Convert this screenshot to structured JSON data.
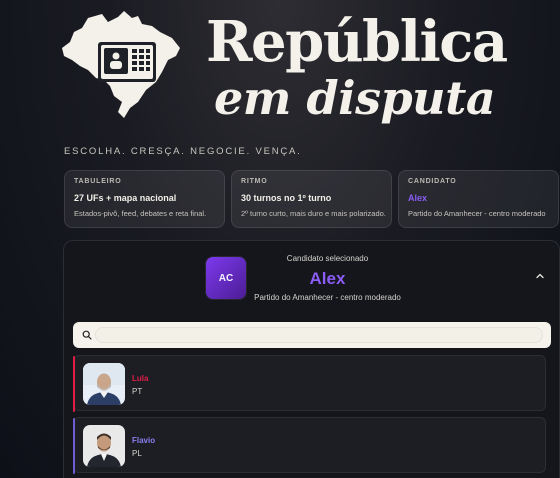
{
  "hero": {
    "title_line1": "República",
    "title_line2": "em disputa",
    "tagline": "ESCOLHA. CRESÇA. NEGOCIE. VENÇA."
  },
  "cards": [
    {
      "label": "TABULEIRO",
      "value": "27 UFs + mapa nacional",
      "desc": "Estados-pivô, feed, debates e reta final."
    },
    {
      "label": "RITMO",
      "value": "30 turnos no 1º turno",
      "desc": "2º turno curto, mais duro e mais polarizado."
    },
    {
      "label": "CANDIDATO",
      "value": "Alex",
      "desc": "Partido do Amanhecer - centro moderado"
    }
  ],
  "selected": {
    "label": "Candidato selecionado",
    "initials": "AC",
    "name": "Alex",
    "party": "Partido do Amanhecer - centro moderado"
  },
  "search": {
    "placeholder": "",
    "icon": "search-icon"
  },
  "candidates": [
    {
      "name": "Lula",
      "party": "PT",
      "color": "#e11d48"
    },
    {
      "name": "Flavio",
      "party": "PL",
      "color": "#6d5dd3"
    }
  ],
  "colors": {
    "accent": "#8b5cf6",
    "background": "#14161c"
  }
}
